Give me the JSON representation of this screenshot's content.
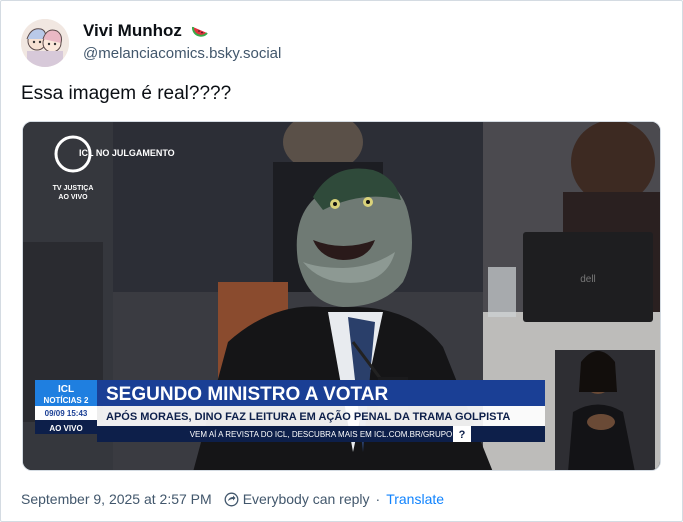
{
  "post": {
    "author": {
      "display_name": "Vivi Munhoz",
      "name_emoji_icon": "watermelon-icon",
      "handle": "@melanciacomics.bsky.social",
      "avatar_icon": "avatar-illustration"
    },
    "text": "Essa imagem é real????",
    "media": {
      "channel_logo": "ICL NO JULGAMENTO",
      "source_line1": "TV JUSTIÇA",
      "source_line2": "AO VIVO",
      "brand_top": "ICL",
      "brand_bottom": "NOTÍCIAS 2",
      "date_time": "09/09 15:43",
      "live_badge": "AO VIVO",
      "headline": "SEGUNDO MINISTRO A VOTAR",
      "subheadline": "APÓS MORAES, DINO FAZ LEITURA EM AÇÃO PENAL DA TRAMA GOLPISTA",
      "ticker": "VEM AÍ A REVISTA DO ICL, DESCUBRA MAIS EM ICL.COM.BR/GRUPO",
      "laptop_brand": "dell",
      "colors": {
        "banner_blue": "#1a3f95",
        "accent_blue": "#1f7fe0",
        "dark_navy": "#0d1f4a"
      }
    },
    "footer": {
      "timestamp": "September 9, 2025 at 2:57 PM",
      "reply_icon": "reply-permission-icon",
      "reply_setting": "Everybody can reply",
      "separator": "·",
      "translate": "Translate"
    }
  }
}
